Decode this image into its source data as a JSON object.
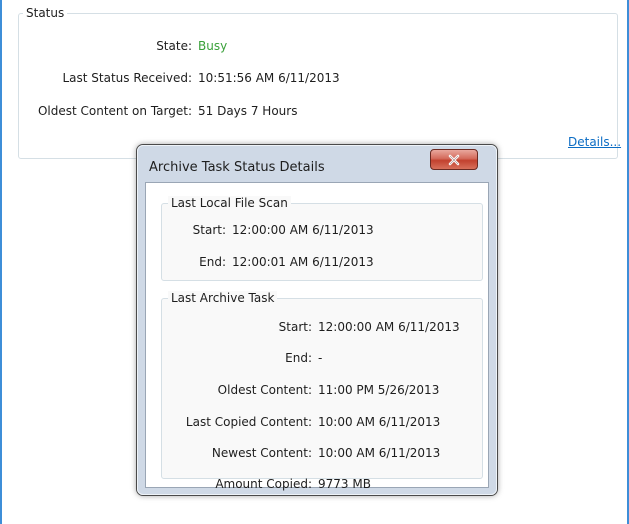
{
  "status": {
    "legend": "Status",
    "state_label": "State:",
    "state_value": "Busy",
    "last_received_label": "Last Status Received:",
    "last_received_value": "10:51:56 AM 6/11/2013",
    "oldest_label": "Oldest Content on Target:",
    "oldest_value": "51 Days 7 Hours",
    "details_link": "Details..."
  },
  "dialog": {
    "title": "Archive Task Status Details",
    "close_glyph": "x",
    "local_scan": {
      "legend": "Last Local File Scan",
      "start_label": "Start:",
      "start_value": "12:00:00 AM 6/11/2013",
      "end_label": "End:",
      "end_value": "12:00:01 AM 6/11/2013"
    },
    "archive_task": {
      "legend": "Last Archive Task",
      "start_label": "Start:",
      "start_value": "12:00:00 AM 6/11/2013",
      "end_label": "End:",
      "end_value": "-",
      "oldest_label": "Oldest Content:",
      "oldest_value": "11:00 PM 5/26/2013",
      "last_copied_label": "Last Copied Content:",
      "last_copied_value": "10:00 AM 6/11/2013",
      "newest_label": "Newest Content:",
      "newest_value": "10:00 AM 6/11/2013",
      "amount_label": "Amount Copied:",
      "amount_value": "9773 MB"
    }
  },
  "colors": {
    "state_busy": "#3aa13a",
    "link": "#0b6cc4",
    "close_button": "#c2412e",
    "frame": "#3d8ed8"
  }
}
